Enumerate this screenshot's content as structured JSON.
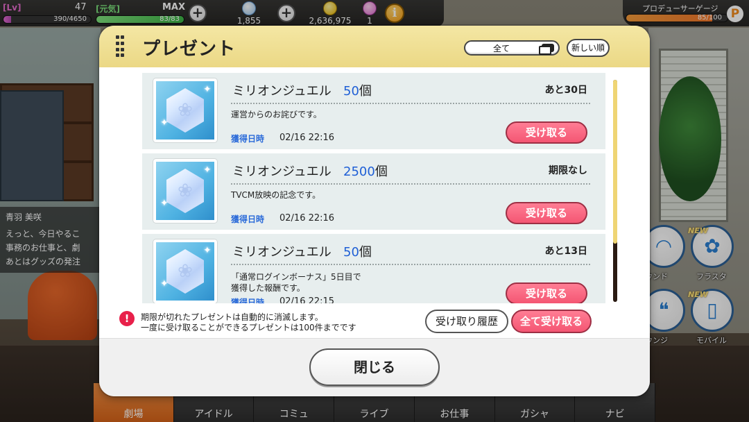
{
  "status": {
    "lv_label": "[Lv]",
    "lv_value": "47",
    "genki_label": "[元気]",
    "max_label": "MAX",
    "exp_text": "390/4650",
    "exp_progress": 0.084,
    "stamina_text": "83/83",
    "stamina_progress": 1.0,
    "jewel_count": "1,855",
    "money_count": "2,636,975",
    "ticket_count": "1",
    "producer_gauge_label": "プロデューサーゲージ",
    "producer_gauge_text": "85/100",
    "producer_gauge_progress": 0.85,
    "p_icon_letter": "P",
    "plus_symbol": "+",
    "info_symbol": "i"
  },
  "dialog": {
    "name": "青羽 美咲",
    "lines": [
      "えっと、今日やるこ",
      "事務のお仕事と、劇",
      "あとはグッズの発注"
    ]
  },
  "side_menu": {
    "items": [
      {
        "label": "ウンド",
        "icon": "headphones-icon",
        "new": false
      },
      {
        "label": "フラスタ",
        "icon": "flower-icon",
        "new": true
      },
      {
        "label": "ウンジ",
        "icon": "chat-icon",
        "new": false
      },
      {
        "label": "モバイル",
        "icon": "phone-icon",
        "new": true
      }
    ],
    "new_badge": "NEW"
  },
  "bottom_nav": {
    "tabs": [
      "劇場",
      "アイドル",
      "コミュ",
      "ライブ",
      "お仕事",
      "ガシャ",
      "ナビ"
    ],
    "active_index": 0
  },
  "modal": {
    "title": "プレゼント",
    "filter_value": "全て",
    "sort_label": "新しい順",
    "date_label": "獲得日時",
    "receive_label": "受け取る",
    "items": [
      {
        "name": "ミリオンジュエル",
        "count": "50",
        "unit": "個",
        "expiry": "あと30日",
        "desc": "運営からのお詫びです。",
        "date": "02/16 22:16"
      },
      {
        "name": "ミリオンジュエル",
        "count": "2500",
        "unit": "個",
        "expiry": "期限なし",
        "desc": "TVCM放映の記念です。",
        "date": "02/16 22:16"
      },
      {
        "name": "ミリオンジュエル",
        "count": "50",
        "unit": "個",
        "expiry": "あと13日",
        "desc": "「通常ログインボーナス」5日目で\n獲得した報酬です。",
        "date": "02/16 22:15"
      }
    ],
    "notice_line1": "期限が切れたプレゼントは自動的に消滅します。",
    "notice_line2": "一度に受け取ることができるプレゼントは100件までです",
    "notice_symbol": "!",
    "history_label": "受け取り履歴",
    "receive_all_label": "全て受け取る",
    "close_label": "閉じる"
  },
  "colors": {
    "accent_pink": "#f45673",
    "header_yellow": "#ebd885",
    "count_blue": "#1f5fd6",
    "nav_active": "#f0762a"
  }
}
